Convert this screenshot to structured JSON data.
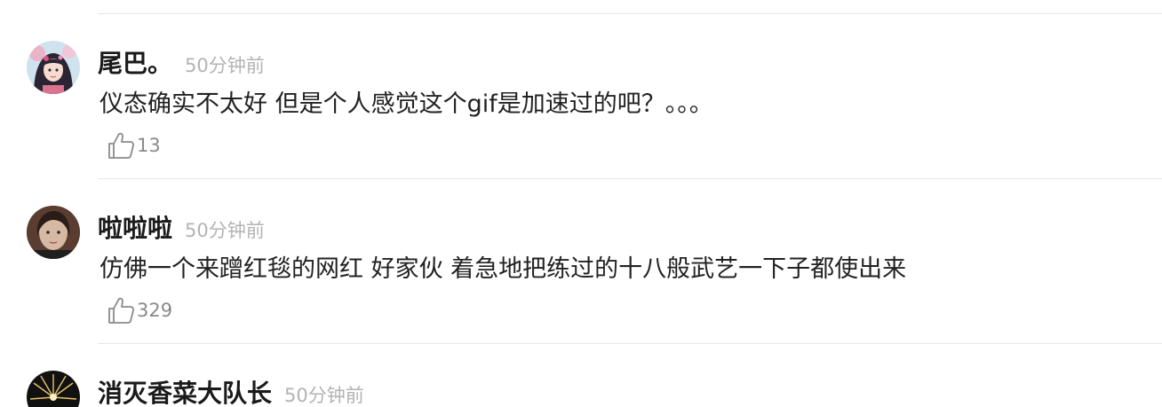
{
  "comments": [
    {
      "username": "尾巴。",
      "time": "50分钟前",
      "text": "仪态确实不太好 但是个人感觉这个gif是加速过的吧？。。。",
      "likes": "13",
      "avatar_icon": "anime-girl-avatar"
    },
    {
      "username": "啦啦啦",
      "time": "50分钟前",
      "text": "仿佛一个来蹭红毯的网红 好家伙 着急地把练过的十八般武艺一下子都使出来",
      "likes": "329",
      "avatar_icon": "portrait-avatar"
    },
    {
      "username": "消灭香菜大队长",
      "time": "50分钟前",
      "avatar_icon": "firework-avatar"
    }
  ],
  "colors": {
    "text": "#222222",
    "muted": "#b3b3b3",
    "like_count": "#8a8a8a",
    "divider": "#e6e6e6"
  }
}
